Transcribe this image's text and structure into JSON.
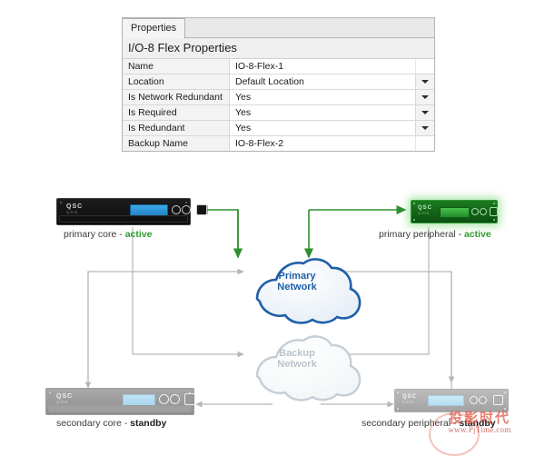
{
  "properties_panel": {
    "tab_label": "Properties",
    "title": "I/O-8 Flex Properties",
    "rows": [
      {
        "key": "Name",
        "value": "IO-8-Flex-1",
        "dropdown": false
      },
      {
        "key": "Location",
        "value": "Default Location",
        "dropdown": true
      },
      {
        "key": "Is Network Redundant",
        "value": "Yes",
        "dropdown": true
      },
      {
        "key": "Is Required",
        "value": "Yes",
        "dropdown": true
      },
      {
        "key": "Is Redundant",
        "value": "Yes",
        "dropdown": true
      },
      {
        "key": "Backup Name",
        "value": "IO-8-Flex-2",
        "dropdown": false
      }
    ]
  },
  "diagram": {
    "clouds": [
      {
        "id": "primary-network",
        "line1": "Primary",
        "line2": "Network",
        "color": "#1f5fa8",
        "state": "active"
      },
      {
        "id": "backup-network",
        "line1": "Backup",
        "line2": "Network",
        "color": "#b9c3cc",
        "state": "inactive"
      }
    ],
    "devices": [
      {
        "id": "primary-core",
        "label_prefix": "primary core - ",
        "state": "active",
        "state_label": "active"
      },
      {
        "id": "primary-peripheral",
        "label_prefix": "primary peripheral - ",
        "state": "active",
        "state_label": "active"
      },
      {
        "id": "secondary-core",
        "label_prefix": "secondary core - ",
        "state": "standby",
        "state_label": "standby"
      },
      {
        "id": "secondary-peripheral",
        "label_prefix": "secondary peripheral - ",
        "state": "standby",
        "state_label": "standby"
      }
    ],
    "brand": "QSC",
    "brand_sub": "Q-SYS",
    "colors": {
      "active_link": "#2f8f2f",
      "inactive_link": "#b6b6b6",
      "primary_cloud": "#1f5fa8",
      "backup_cloud": "#c5ced6",
      "active_text": "#2f9b2f",
      "standby_text": "#1e1e1e"
    }
  },
  "watermark": {
    "text_cn": "投影时代",
    "url": "www.PjTime.com"
  }
}
